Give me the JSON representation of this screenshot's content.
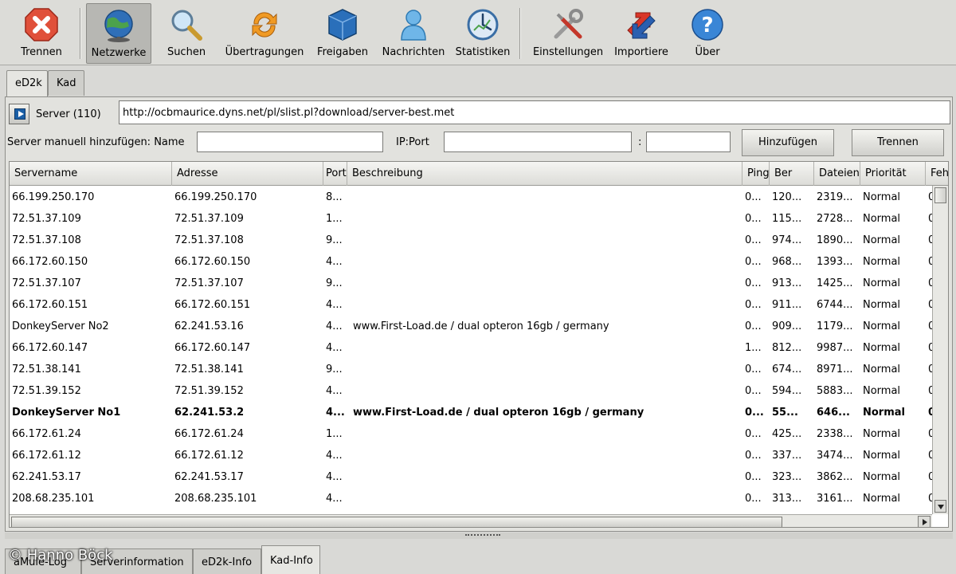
{
  "toolbar": {
    "items": [
      {
        "label": "Trennen",
        "icon": "close-icon"
      },
      {
        "label": "Netzwerke",
        "icon": "globe-icon"
      },
      {
        "label": "Suchen",
        "icon": "magnifier-icon"
      },
      {
        "label": "Übertragungen",
        "icon": "transfer-icon"
      },
      {
        "label": "Freigaben",
        "icon": "shared-box-icon"
      },
      {
        "label": "Nachrichten",
        "icon": "user-icon"
      },
      {
        "label": "Statistiken",
        "icon": "stats-icon"
      },
      {
        "label": "Einstellungen",
        "icon": "tools-icon"
      },
      {
        "label": "Importiere",
        "icon": "import-icon"
      },
      {
        "label": "Über",
        "icon": "help-icon"
      }
    ],
    "active": "Netzwerke"
  },
  "tabs": [
    "eD2k",
    "Kad"
  ],
  "server": {
    "label": "Server (110)",
    "url": "http://ocbmaurice.dyns.net/pl/slist.pl?download/server-best.met"
  },
  "manual_add": {
    "name_label": "Server manuell hinzufügen: Name",
    "ipport_label": "IP:Port",
    "colon": ":",
    "add_button": "Hinzufügen",
    "disconnect_button": "Trennen"
  },
  "table": {
    "columns": [
      "Servername",
      "Adresse",
      "Port",
      "Beschreibung",
      "Ping",
      "Ber",
      "Dateien",
      "Priorität",
      "Feh"
    ],
    "rows": [
      [
        "66.199.250.170",
        "66.199.250.170",
        "8...",
        "",
        "0...",
        "120...",
        "2319...",
        "Normal",
        "0"
      ],
      [
        "72.51.37.109",
        "72.51.37.109",
        "1...",
        "",
        "0...",
        "115...",
        "2728...",
        "Normal",
        "0"
      ],
      [
        "72.51.37.108",
        "72.51.37.108",
        "9...",
        "",
        "0...",
        "974...",
        "1890...",
        "Normal",
        "0"
      ],
      [
        "66.172.60.150",
        "66.172.60.150",
        "4...",
        "",
        "0...",
        "968...",
        "1393...",
        "Normal",
        "0"
      ],
      [
        "72.51.37.107",
        "72.51.37.107",
        "9...",
        "",
        "0...",
        "913...",
        "1425...",
        "Normal",
        "0"
      ],
      [
        "66.172.60.151",
        "66.172.60.151",
        "4...",
        "",
        "0...",
        "911...",
        "6744...",
        "Normal",
        "0"
      ],
      [
        "DonkeyServer No2",
        "62.241.53.16",
        "4...",
        "www.First-Load.de / dual opteron 16gb / germany",
        "0...",
        "909...",
        "1179...",
        "Normal",
        "0"
      ],
      [
        "66.172.60.147",
        "66.172.60.147",
        "4...",
        "",
        "1...",
        "812...",
        "9987...",
        "Normal",
        "0"
      ],
      [
        "72.51.38.141",
        "72.51.38.141",
        "9...",
        "",
        "0...",
        "674...",
        "8971...",
        "Normal",
        "0"
      ],
      [
        "72.51.39.152",
        "72.51.39.152",
        "4...",
        "",
        "0...",
        "594...",
        "5883...",
        "Normal",
        "0"
      ],
      [
        "DonkeyServer No1",
        "62.241.53.2",
        "4...",
        "www.First-Load.de / dual opteron 16gb / germany",
        "0...",
        "55...",
        "646...",
        "Normal",
        "0"
      ],
      [
        "66.172.61.24",
        "66.172.61.24",
        "1...",
        "",
        "0...",
        "425...",
        "2338...",
        "Normal",
        "0"
      ],
      [
        "66.172.61.12",
        "66.172.61.12",
        "4...",
        "",
        "0...",
        "337...",
        "3474...",
        "Normal",
        "0"
      ],
      [
        "62.241.53.17",
        "62.241.53.17",
        "4...",
        "",
        "0...",
        "323...",
        "3862...",
        "Normal",
        "0"
      ],
      [
        "208.68.235.101",
        "208.68.235.101",
        "4...",
        "",
        "0...",
        "313...",
        "3161...",
        "Normal",
        "0"
      ]
    ],
    "bold_row": 10
  },
  "bottom_tabs": [
    "aMule-Log",
    "Serverinformation",
    "eD2k-Info",
    "Kad-Info"
  ],
  "copyright": "© Hanno Böck"
}
